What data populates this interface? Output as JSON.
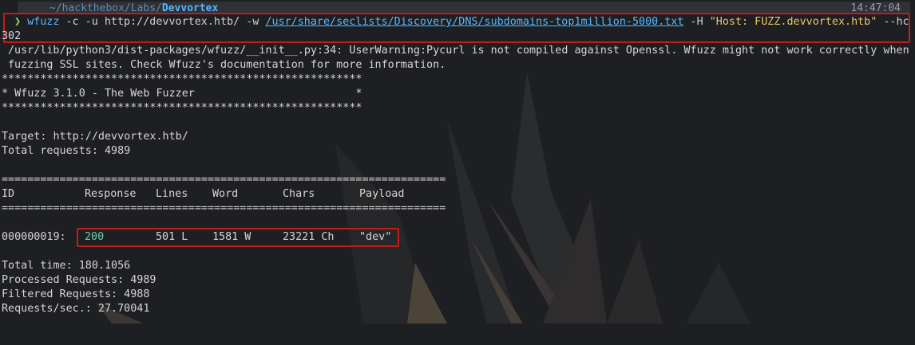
{
  "prompt": {
    "path": "~/hackthebox/Labs/",
    "dir": "Devvortex",
    "time": "14:47:04",
    "chevron": "❯"
  },
  "command": {
    "tool": "wfuzz",
    "opts1": " -c -u http://devvortex.htb/ -w ",
    "wordlist": "/usr/share/seclists/Discovery/DNS/subdomains-top1million-5000.txt",
    "opts2": " -H ",
    "header": "\"Host: FUZZ.devvortex.htb\"",
    "opts3": " --hc",
    "cont": "302"
  },
  "output": {
    "warn1": "/usr/lib/python3/dist-packages/wfuzz/__init__.py:34: UserWarning:Pycurl is not compiled against Openssl. Wfuzz might not work correctly when",
    "warn2": "fuzzing SSL sites. Check Wfuzz's documentation for more information.",
    "stars": "********************************************************",
    "banner": "* Wfuzz 3.1.0 - The Web Fuzzer                         *",
    "target": "Target: http://devvortex.htb/",
    "total": "Total requests: 4989",
    "sep": "=====================================================================",
    "columns": [
      "ID",
      "Response",
      "Lines",
      "Word",
      "Chars",
      "Payload"
    ],
    "result": {
      "id": "000000019:",
      "response": "200",
      "lines": "501 L",
      "word": "1581 W",
      "chars": "23221 Ch",
      "payload": "\"dev\""
    },
    "total_time": "Total time: 180.1056",
    "processed": "Processed Requests: 4989",
    "filtered": "Filtered Requests: 4988",
    "rate": "Requests/sec.: 27.70041"
  },
  "colors": {
    "background": "#1e1f22",
    "text": "#d6d6d6",
    "command": "#57b7ff",
    "string": "#e8c566",
    "status_ok": "#68d6a6",
    "highlight_box": "#c21c1c"
  }
}
